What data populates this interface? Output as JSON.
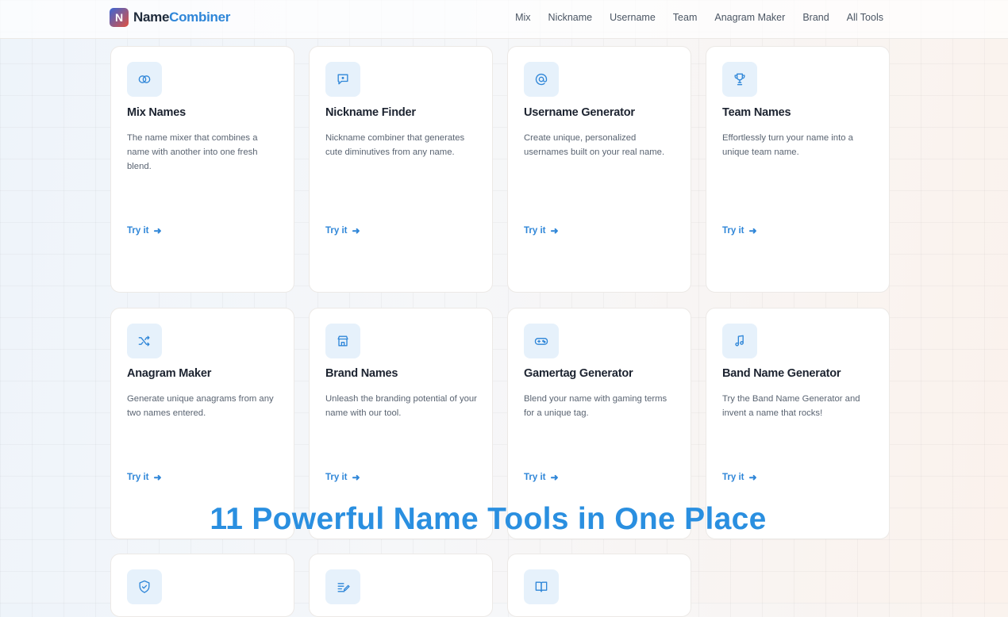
{
  "brand": {
    "letter": "N",
    "name_part1": "Name",
    "name_part2": "Combiner"
  },
  "nav": [
    "Mix",
    "Nickname",
    "Username",
    "Team",
    "Anagram Maker",
    "Brand",
    "All Tools"
  ],
  "cards": [
    {
      "title": "Mix Names",
      "desc": "The name mixer that combines a name with another into one fresh blend.",
      "cta": "Try it",
      "icon": "rings-icon"
    },
    {
      "title": "Nickname Finder",
      "desc": "Nickname combiner that generates cute diminutives from any name.",
      "cta": "Try it",
      "icon": "chat-bubble-icon"
    },
    {
      "title": "Username Generator",
      "desc": "Create unique, personalized usernames built on your real name.",
      "cta": "Try it",
      "icon": "at-sign-icon"
    },
    {
      "title": "Team Names",
      "desc": "Effortlessly turn your name into a unique team name.",
      "cta": "Try it",
      "icon": "trophy-icon"
    },
    {
      "title": "Anagram Maker",
      "desc": "Generate unique anagrams from any two names entered.",
      "cta": "Try it",
      "icon": "shuffle-icon"
    },
    {
      "title": "Brand Names",
      "desc": "Unleash the branding potential of your name with our tool.",
      "cta": "Try it",
      "icon": "store-icon"
    },
    {
      "title": "Gamertag Generator",
      "desc": "Blend your name with gaming terms for a unique tag.",
      "cta": "Try it",
      "icon": "gamepad-icon"
    },
    {
      "title": "Band Name Generator",
      "desc": "Try the Band Name Generator and invent a name that rocks!",
      "cta": "Try it",
      "icon": "music-note-icon"
    },
    {
      "icon": "shield-check-icon"
    },
    {
      "icon": "edit-note-icon"
    },
    {
      "icon": "book-icon"
    }
  ],
  "overlay_title": "11 Powerful Name Tools in One Place",
  "colors": {
    "accent": "#2f86d8",
    "overlay": "#2a8fe0",
    "icon_bg": "#e6f1fb"
  }
}
